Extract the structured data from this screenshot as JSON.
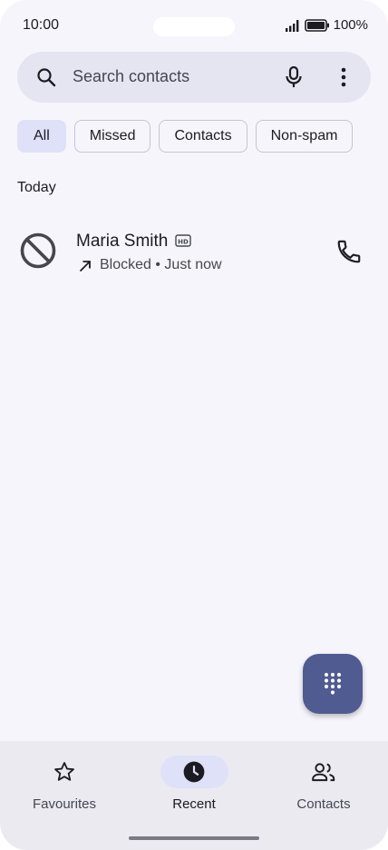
{
  "status_bar": {
    "time": "10:00",
    "battery": "100%"
  },
  "search": {
    "placeholder": "Search contacts",
    "icons": [
      "search-icon",
      "mic-icon",
      "more-vert-icon"
    ]
  },
  "filters": [
    {
      "label": "All",
      "selected": true
    },
    {
      "label": "Missed",
      "selected": false
    },
    {
      "label": "Contacts",
      "selected": false
    },
    {
      "label": "Non-spam",
      "selected": false
    }
  ],
  "section": {
    "label": "Today"
  },
  "calls": [
    {
      "name": "Maria Smith",
      "status": "Blocked • Just now",
      "direction_icon": "outgoing-arrow-icon",
      "avatar_icon": "blocked-icon",
      "hd_badge_icon": "hd-icon",
      "action_icon": "phone-icon"
    }
  ],
  "fab": {
    "icon": "dialpad-icon"
  },
  "bottom_nav": [
    {
      "label": "Favourites",
      "icon": "star-icon",
      "active": false
    },
    {
      "label": "Recent",
      "icon": "clock-icon",
      "active": true
    },
    {
      "label": "Contacts",
      "icon": "people-icon",
      "active": false
    }
  ],
  "colors": {
    "background": "#f7f5fc",
    "search_bar": "#e5e4f1",
    "selected_chip": "#dfe1f9",
    "fab": "#4f5b91",
    "nav_bar": "#ebeaf1"
  }
}
